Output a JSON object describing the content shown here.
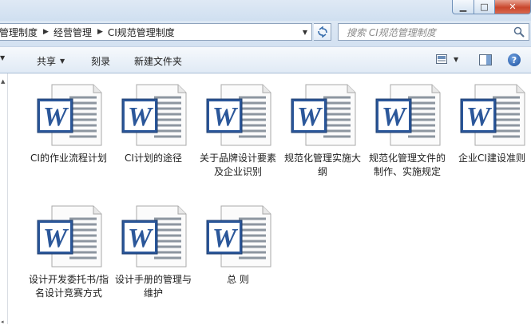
{
  "window": {
    "controls": {
      "minimize": "▁",
      "maximize": "□",
      "close": "✕"
    }
  },
  "address": {
    "crumbs": [
      "管理制度",
      "经营管理",
      "CI规范管理制度"
    ],
    "separator": "▶",
    "dropdown_icon": "chevron-down-icon"
  },
  "search": {
    "placeholder": "搜索 CI规范管理制度"
  },
  "toolbar": {
    "share_label": "共享",
    "burn_label": "刻录",
    "new_folder_label": "新建文件夹",
    "help_label": "?"
  },
  "files": [
    {
      "name": "CI的作业流程计划",
      "type": "word-document-icon"
    },
    {
      "name": "CI计划的途径",
      "type": "word-document-icon"
    },
    {
      "name": "关于品牌设计要素及企业识别",
      "type": "word-document-icon"
    },
    {
      "name": "规范化管理实施大纲",
      "type": "word-document-icon"
    },
    {
      "name": "规范化管理文件的制作、实施规定",
      "type": "word-document-icon"
    },
    {
      "name": "企业CI建设准则",
      "type": "word-document-icon"
    },
    {
      "name": "设计开发委托书/指名设计竞赛方式",
      "type": "word-document-icon"
    },
    {
      "name": "设计手册的管理与维护",
      "type": "word-document-icon"
    },
    {
      "name": "总 则",
      "type": "word-document-icon"
    }
  ],
  "colors": {
    "word_blue": "#2b579a",
    "accent": "#3a6fae"
  }
}
